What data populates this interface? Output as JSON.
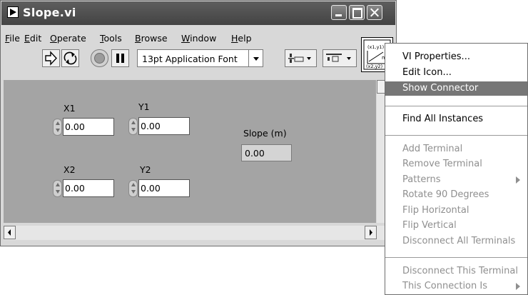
{
  "window": {
    "title": "Slope.vi",
    "menu": [
      {
        "key": "F",
        "rest": "ile"
      },
      {
        "key": "E",
        "rest": "dit"
      },
      {
        "key": "O",
        "rest": "perate"
      },
      {
        "key": "T",
        "rest": "ools"
      },
      {
        "key": "B",
        "rest": "rowse"
      },
      {
        "key": "W",
        "rest": "indow"
      },
      {
        "key": "H",
        "rest": "elp"
      }
    ],
    "toolbar": {
      "font": "13pt Application Font"
    },
    "connector_icon_text": {
      "top": "(x1,y1)",
      "m": "m",
      "bottom": "(x2,y2)"
    }
  },
  "panel": {
    "x1": {
      "label": "X1",
      "value": "0.00"
    },
    "y1": {
      "label": "Y1",
      "value": "0.00"
    },
    "x2": {
      "label": "X2",
      "value": "0.00"
    },
    "y2": {
      "label": "Y2",
      "value": "0.00"
    },
    "slope": {
      "label": "Slope (m)",
      "value": "0.00"
    }
  },
  "context_menu": {
    "items": [
      {
        "label": "VI Properties...",
        "enabled": true
      },
      {
        "label": "Edit Icon...",
        "enabled": true
      },
      {
        "label": "Show Connector",
        "enabled": true,
        "highlighted": true
      },
      {
        "label": "Find All Instances",
        "enabled": true
      },
      {
        "label": "Add Terminal",
        "enabled": false
      },
      {
        "label": "Remove Terminal",
        "enabled": false
      },
      {
        "label": "Patterns",
        "enabled": false,
        "submenu": true
      },
      {
        "label": "Rotate 90 Degrees",
        "enabled": false
      },
      {
        "label": "Flip Horizontal",
        "enabled": false
      },
      {
        "label": "Flip Vertical",
        "enabled": false
      },
      {
        "label": "Disconnect All Terminals",
        "enabled": false
      },
      {
        "label": "Disconnect This Terminal",
        "enabled": false
      },
      {
        "label": "This Connection Is",
        "enabled": false,
        "submenu": true
      }
    ]
  },
  "colors": {
    "titlebar": "#4d4d4d",
    "panel": "#a4a4a4",
    "highlight": "#767676",
    "disabled_text": "#8f8f8f"
  }
}
